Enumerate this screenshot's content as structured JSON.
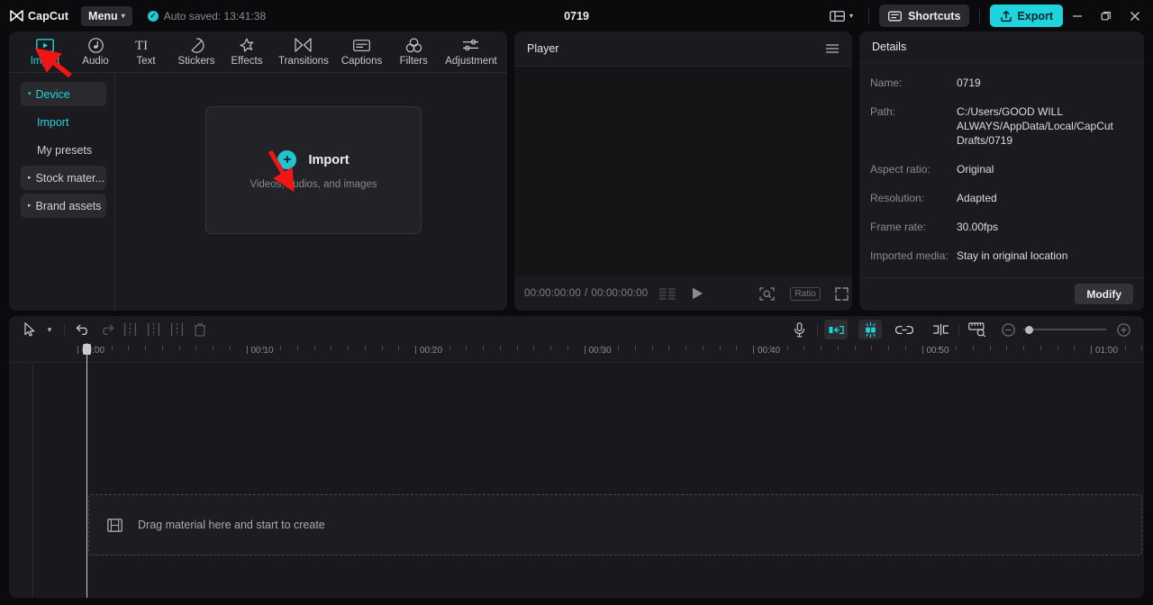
{
  "titlebar": {
    "brand": "CapCut",
    "menu_label": "Menu",
    "autosave_text": "Auto saved: 13:41:38",
    "project_title": "0719",
    "shortcuts_label": "Shortcuts",
    "export_label": "Export",
    "accent_color": "#1fd4dc"
  },
  "tabs": [
    {
      "label": "Import",
      "icon": "media-import-icon",
      "active": true
    },
    {
      "label": "Audio",
      "icon": "music-note-icon",
      "active": false
    },
    {
      "label": "Text",
      "icon": "text-ti-icon",
      "active": false
    },
    {
      "label": "Stickers",
      "icon": "sticker-icon",
      "active": false
    },
    {
      "label": "Effects",
      "icon": "sparkle-effects-icon",
      "active": false
    },
    {
      "label": "Transitions",
      "icon": "transitions-icon",
      "active": false
    },
    {
      "label": "Captions",
      "icon": "captions-icon",
      "active": false
    },
    {
      "label": "Filters",
      "icon": "filters-circles-icon",
      "active": false
    },
    {
      "label": "Adjustment",
      "icon": "adjustment-sliders-icon",
      "active": false
    }
  ],
  "library_sidebar": [
    {
      "label": "Device",
      "type": "group",
      "accent": true,
      "expanded": true
    },
    {
      "label": "Import",
      "type": "sub",
      "accent": true
    },
    {
      "label": "My presets",
      "type": "sub",
      "accent": false
    },
    {
      "label": "Stock mater...",
      "type": "group",
      "accent": false,
      "expanded": false
    },
    {
      "label": "Brand assets",
      "type": "group",
      "accent": false,
      "expanded": false
    }
  ],
  "dropzone": {
    "title": "Import",
    "subtitle": "Videos, audios, and images",
    "plus_glyph": "+"
  },
  "player": {
    "header": "Player",
    "current_time": "00:00:00:00",
    "total_time": "00:00:00:00",
    "time_separator": "/",
    "ratio_label": "Ratio"
  },
  "details": {
    "header": "Details",
    "rows": [
      {
        "label": "Name:",
        "value": "0719"
      },
      {
        "label": "Path:",
        "value": "C:/Users/GOOD WILL ALWAYS/AppData/Local/CapCut Drafts/0719"
      },
      {
        "label": "Aspect ratio:",
        "value": "Original"
      },
      {
        "label": "Resolution:",
        "value": "Adapted"
      },
      {
        "label": "Frame rate:",
        "value": "30.00fps"
      },
      {
        "label": "Imported media:",
        "value": "Stay in original location"
      }
    ],
    "modify_label": "Modify"
  },
  "timeline": {
    "ruler_labels": [
      "00:00",
      "00:10",
      "00:20",
      "00:30",
      "00:40",
      "00:50",
      "01:00"
    ],
    "drop_text": "Drag material here and start to create",
    "zoom_value": 0
  }
}
